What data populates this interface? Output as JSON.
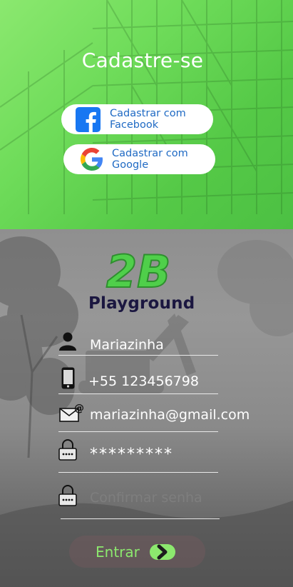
{
  "header": {
    "title": "Cadastre-se",
    "facebook_label": "Cadastrar com Facebook",
    "google_label": "Cadastrar com Google"
  },
  "brand": {
    "logo_text": "2B",
    "name": "Playground"
  },
  "form": {
    "name_value": "Mariazinha",
    "phone_value": "+55 123456798",
    "email_value": "mariazinha@gmail.com",
    "password_value": "*********",
    "confirm_placeholder": "Confirmar senha"
  },
  "submit": {
    "label": "Entrar"
  },
  "colors": {
    "header_green": "#55c947",
    "accent_green": "#8ce86e",
    "link_blue": "#1f6ac4",
    "facebook_blue": "#1877f2",
    "brand_navy": "#1b1740"
  },
  "icons": [
    "facebook-icon",
    "google-icon",
    "user-icon",
    "phone-icon",
    "email-icon",
    "lock-icon",
    "arrow-right-icon"
  ]
}
